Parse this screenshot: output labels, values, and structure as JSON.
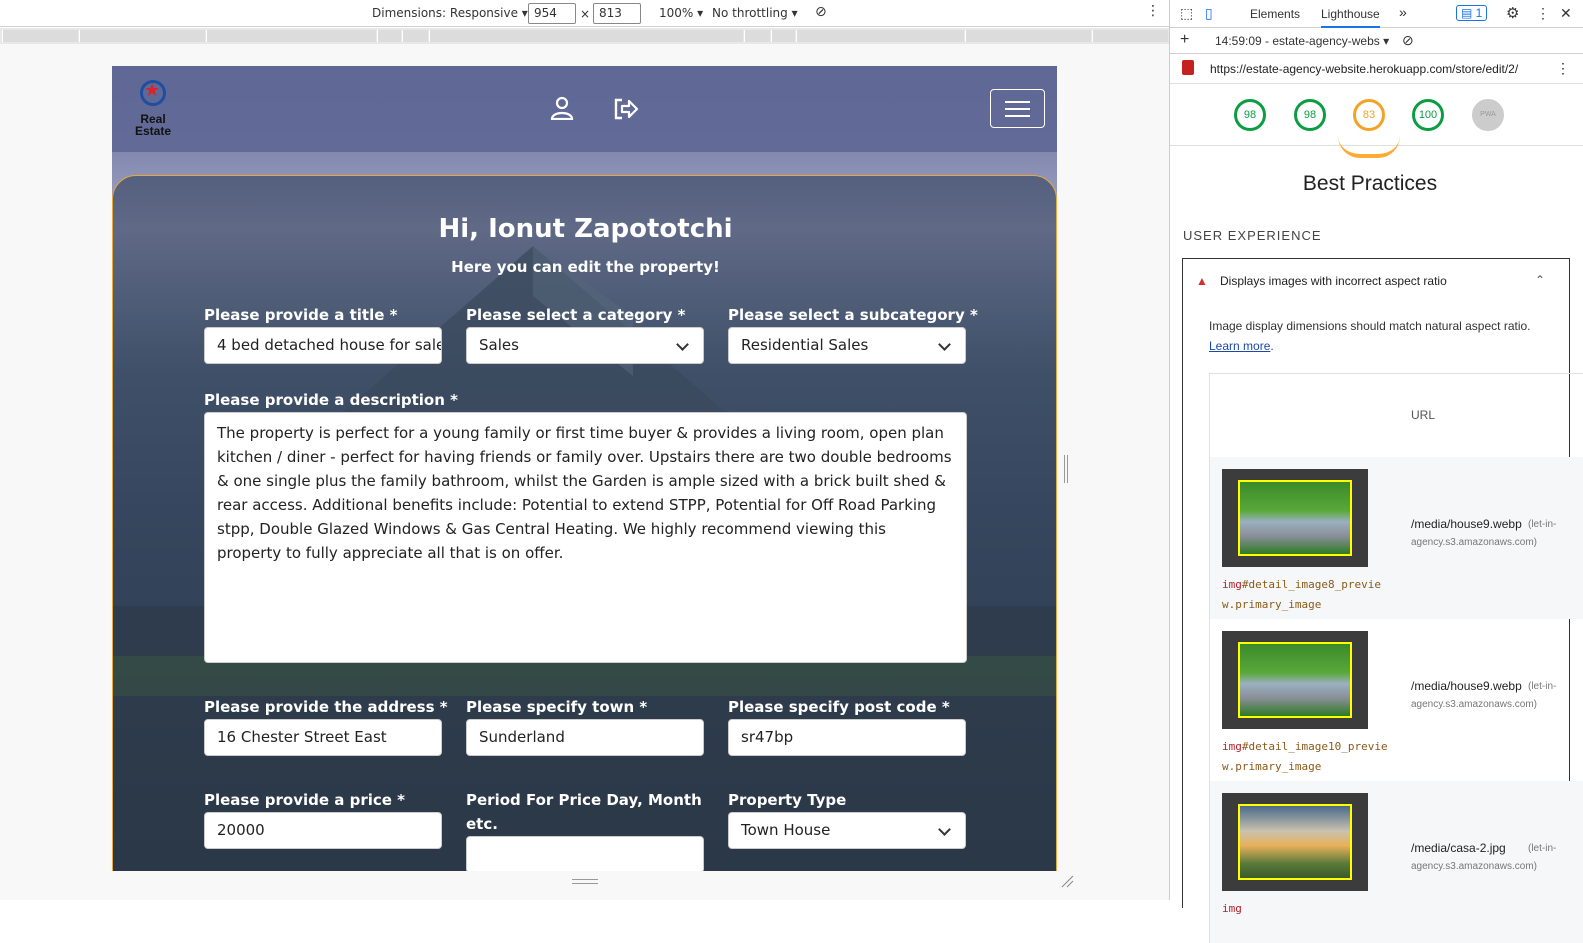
{
  "device_toolbar": {
    "dimensions_label": "Dimensions: Responsive",
    "width": "954",
    "times": "×",
    "height": "813",
    "zoom": "100%",
    "throttling": "No throttling"
  },
  "site": {
    "logo_line1": "Real",
    "logo_line2": "Estate",
    "greeting": "Hi, Ionut Zapototchi",
    "subtitle": "Here you can edit the property!",
    "fields": {
      "title_label": "Please provide a title *",
      "title_value": "4 bed detached house for sale",
      "category_label": "Please select a category *",
      "category_value": "Sales",
      "subcategory_label": "Please select a subcategory *",
      "subcategory_value": "Residential Sales",
      "description_label": "Please provide a description *",
      "description_value": "The property is perfect for a young family or first time buyer & provides a living room, open plan kitchen / diner - perfect for having friends or family over. Upstairs there are two double bedrooms & one single plus the family bathroom, whilst the Garden is ample sized with a brick built shed & rear access. Additional benefits include: Potential to extend STPP, Potential for Off Road Parking stpp, Double Glazed Windows & Gas Central Heating. We highly recommend viewing this property to fully appreciate all that is on offer.",
      "address_label": "Please provide the address *",
      "address_value": "16 Chester Street East",
      "town_label": "Please specify town *",
      "town_value": "Sunderland",
      "postcode_label": "Please specify post code *",
      "postcode_value": "sr47bp",
      "price_label": "Please provide a price *",
      "price_value": "20000",
      "period_label": "Period For Price Day, Month etc.",
      "period_value": "",
      "type_label": "Property Type",
      "type_value": "Town House"
    }
  },
  "devtools": {
    "tabs": [
      "Elements",
      "Lighthouse"
    ],
    "more": "»",
    "issues_count": "1",
    "report_time": "14:59:09 - estate-agency-webs",
    "url": "https://estate-agency-website.herokuapp.com/store/edit/2/",
    "scores": [
      "98",
      "98",
      "83",
      "100"
    ],
    "score_colors": [
      "#0c9d43",
      "#0c9d43",
      "#f4a225",
      "#0c9d43"
    ],
    "pwa_label": "PWA",
    "section_title": "Best Practices",
    "section_subhead": "USER EXPERIENCE",
    "audit_title": "Displays images with incorrect aspect ratio",
    "audit_desc": "Image display dimensions should match natural aspect ratio.",
    "learn_more": "Learn more",
    "period": ".",
    "url_col": "URL",
    "rows": [
      {
        "selector_tag": "img",
        "selector_rest": "#detail_image8_preview.primary_image",
        "path": "/media/house9.webp",
        "host_a": "(let-in-",
        "host_b": "agency.s3.amazonaws.com)"
      },
      {
        "selector_tag": "img",
        "selector_rest": "#detail_image10_preview.primary_image",
        "path": "/media/house9.webp",
        "host_a": "(let-in-",
        "host_b": "agency.s3.amazonaws.com)"
      },
      {
        "selector_tag": "img",
        "selector_rest": "",
        "path": "/media/casa-2.jpg",
        "host_a": "(let-in-",
        "host_b": "agency.s3.amazonaws.com)"
      }
    ]
  }
}
